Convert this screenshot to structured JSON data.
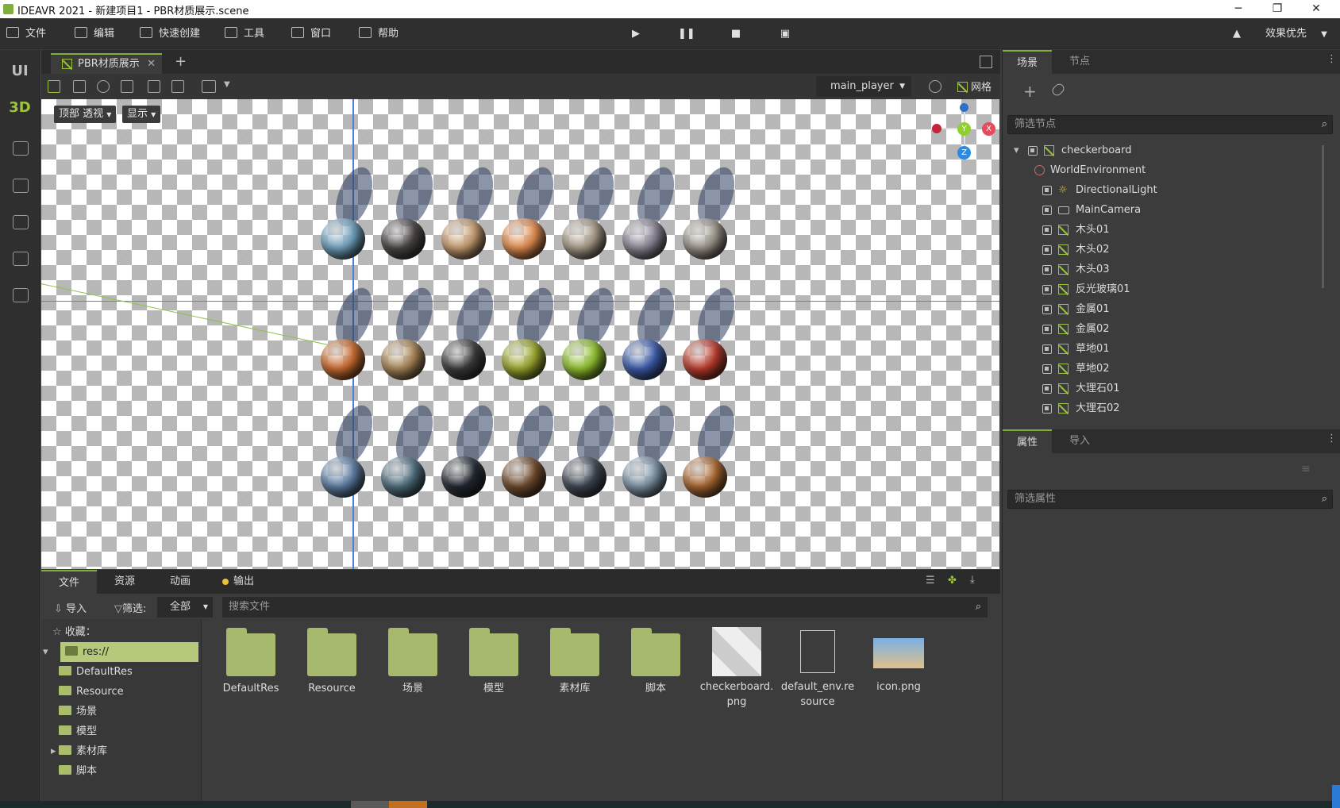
{
  "window": {
    "title": "IDEAVR 2021 - 新建项目1 - PBR材质展示.scene",
    "minimize": "─",
    "restore": "❐",
    "close": "✕"
  },
  "menu": {
    "items": [
      "文件",
      "编辑",
      "快速创建",
      "工具",
      "窗口",
      "帮助"
    ],
    "quality": "效果优先"
  },
  "sidebar": {
    "ui_label": "UI",
    "d3_label": "3D"
  },
  "tabs": {
    "doc_tab": "PBR材质展示",
    "add": "+"
  },
  "viewport": {
    "view_mode": "顶部 透视",
    "display": "显示",
    "player": "main_player",
    "grid": "网格"
  },
  "scene_panel": {
    "tab_scene": "场景",
    "tab_node": "节点",
    "filter_placeholder": "筛选节点",
    "nodes": [
      "checkerboard",
      "WorldEnvironment",
      "DirectionalLight",
      "MainCamera",
      "木头01",
      "木头02",
      "木头03",
      "反光玻璃01",
      "金属01",
      "金属02",
      "草地01",
      "草地02",
      "大理石01",
      "大理石02"
    ]
  },
  "props_panel": {
    "tab_props": "属性",
    "tab_import": "导入",
    "filter_placeholder": "筛选属性"
  },
  "bottom": {
    "tabs": [
      "文件",
      "资源",
      "动画",
      "输出"
    ],
    "import": "导入",
    "filter_label": "筛选:",
    "filter_value": "全部",
    "search_placeholder": "搜索文件",
    "favorites": "收藏：",
    "tree": [
      "res://",
      "DefaultRes",
      "Resource",
      "场景",
      "模型",
      "素材库",
      "脚本"
    ],
    "files": [
      "DefaultRes",
      "Resource",
      "场景",
      "模型",
      "素材库",
      "脚本",
      "checkerboard.png",
      "default_env.resource",
      "icon.png"
    ]
  },
  "spheres": [
    [
      "#6f9fbd",
      "#4a4444",
      "#c59a6e",
      "#e08a4e",
      "#a69a86",
      "#8b8594",
      "#9a9288"
    ],
    [
      "#c86a2e",
      "#a98556",
      "#3a3a3a",
      "#9aa62a",
      "#8fbf2c",
      "#3a5aa8",
      "#b83a2a"
    ],
    [
      "#5f7fa4",
      "#4f6e7e",
      "#222831",
      "#6f4a2c",
      "#3e4652",
      "#7f94a6",
      "#a8662e"
    ]
  ]
}
